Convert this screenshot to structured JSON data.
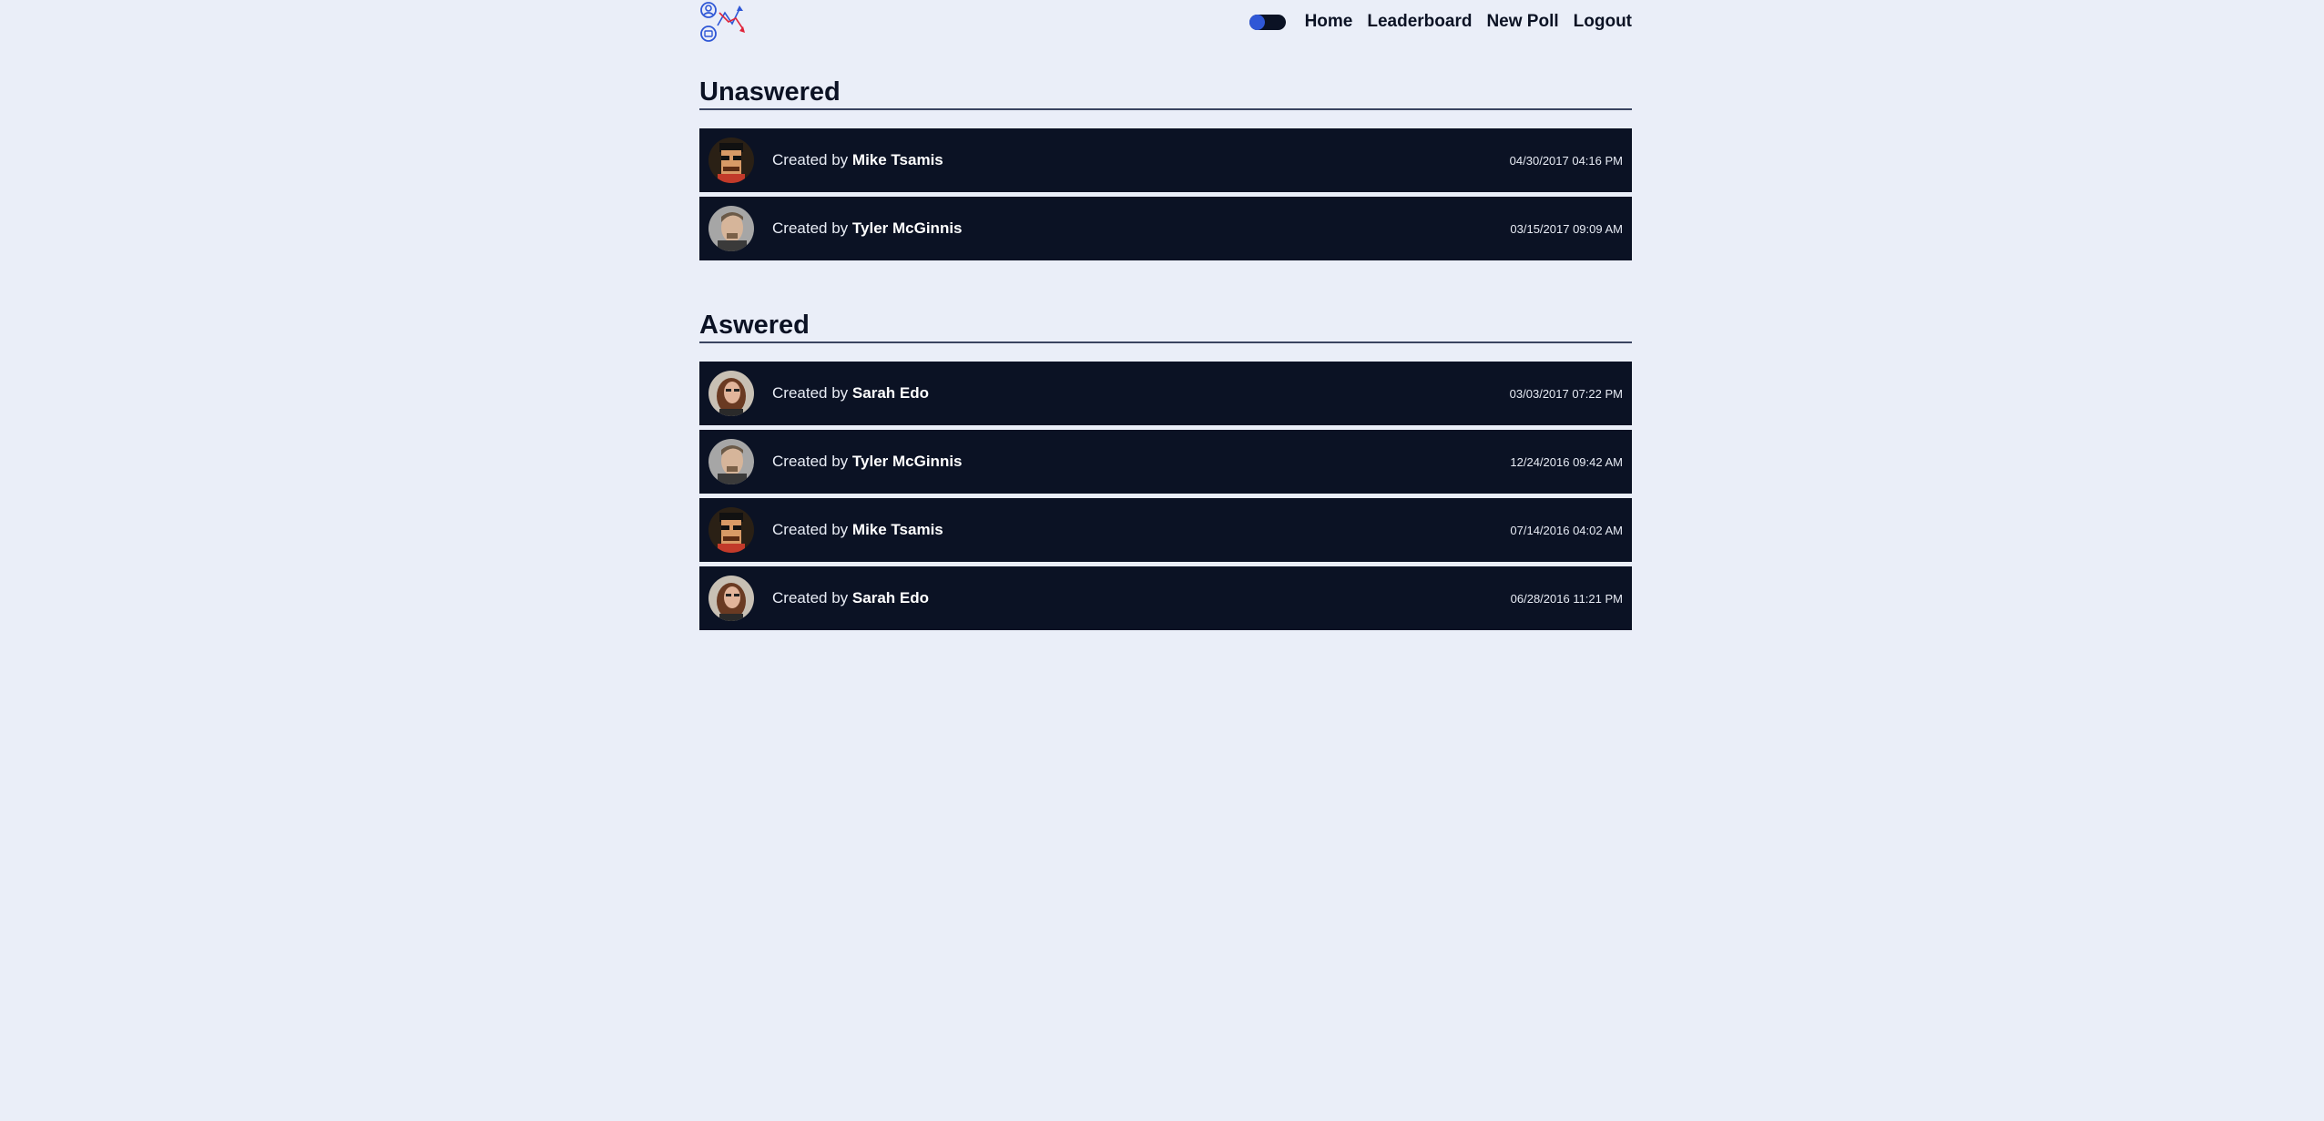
{
  "nav": {
    "toggle_state": "dark-mode-off",
    "links": [
      "Home",
      "Leaderboard",
      "New Poll",
      "Logout"
    ]
  },
  "colors": {
    "background": "#eaeef8",
    "row": "#0b1224",
    "accent": "#2f57d6",
    "logo_red": "#e0243a"
  },
  "sections": [
    {
      "title": "Unaswered",
      "polls": [
        {
          "prefix": "Created by",
          "author": "Mike Tsamis",
          "date": "04/30/2017 04:16 PM",
          "avatar": "mike"
        },
        {
          "prefix": "Created by",
          "author": "Tyler McGinnis",
          "date": "03/15/2017 09:09 AM",
          "avatar": "tyler"
        }
      ]
    },
    {
      "title": "Aswered",
      "polls": [
        {
          "prefix": "Created by",
          "author": "Sarah Edo",
          "date": "03/03/2017 07:22 PM",
          "avatar": "sarah"
        },
        {
          "prefix": "Created by",
          "author": "Tyler McGinnis",
          "date": "12/24/2016 09:42 AM",
          "avatar": "tyler"
        },
        {
          "prefix": "Created by",
          "author": "Mike Tsamis",
          "date": "07/14/2016 04:02 AM",
          "avatar": "mike"
        },
        {
          "prefix": "Created by",
          "author": "Sarah Edo",
          "date": "06/28/2016 11:21 PM",
          "avatar": "sarah"
        }
      ]
    }
  ]
}
